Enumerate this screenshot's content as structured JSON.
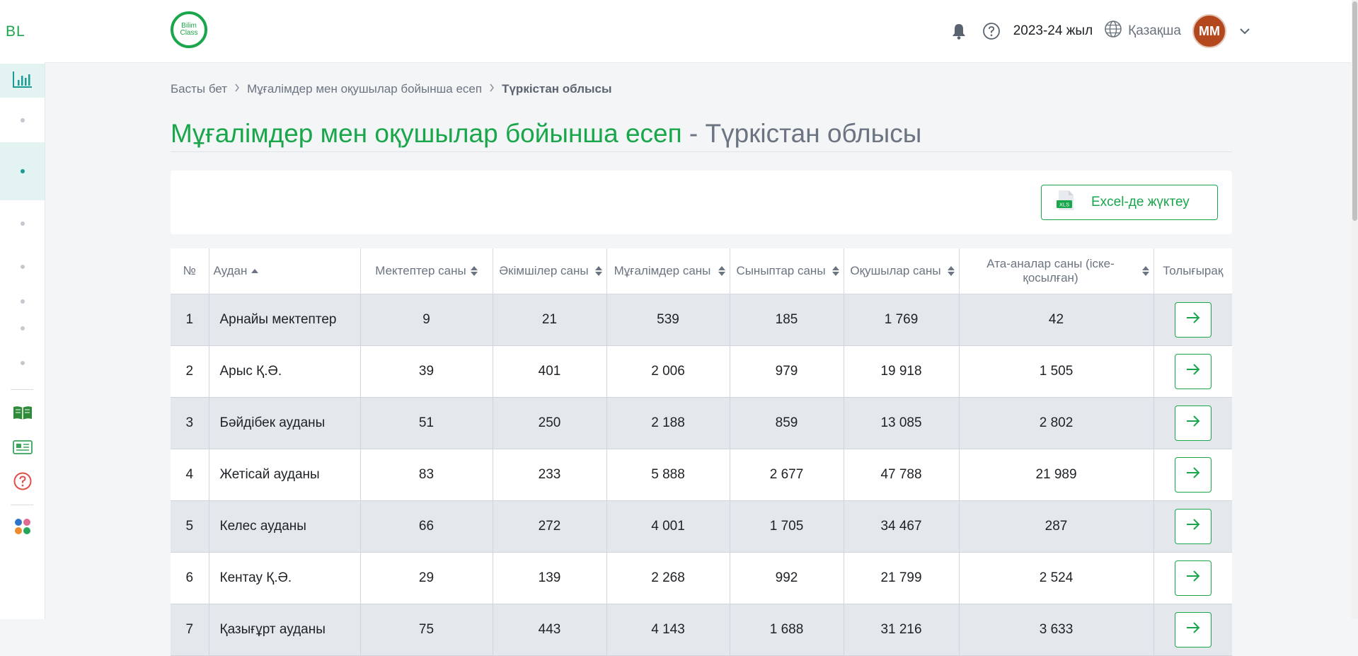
{
  "sidebar": {
    "logo": "BL",
    "items": [
      {
        "icon": "bar-chart-icon",
        "active": true
      },
      {
        "icon": "dot"
      },
      {
        "icon": "dot",
        "active": true
      },
      {
        "icon": "dot"
      },
      {
        "icon": "dot"
      },
      {
        "icon": "dot"
      },
      {
        "icon": "dot"
      },
      {
        "icon": "dot"
      },
      {
        "icon": "book-icon"
      },
      {
        "icon": "news-icon"
      },
      {
        "icon": "help-icon"
      },
      {
        "icon": "apps-icon"
      }
    ]
  },
  "header": {
    "brand_line1": "Bilim",
    "brand_line2": "Class",
    "year": "2023-24 жыл",
    "language": "Қазақша",
    "avatar_initials": "MM"
  },
  "breadcrumb": {
    "home": "Басты бет",
    "report": "Мұғалімдер мен оқушылар бойынша есеп",
    "current": "Түркістан облысы"
  },
  "title": {
    "main": "Мұғалімдер мен оқушылар бойынша есеп",
    "region": " - Түркістан облысы"
  },
  "toolbar": {
    "excel_label": "Excel-де жүктеу",
    "excel_badge": "XLS"
  },
  "table": {
    "headers": {
      "num": "№",
      "district": "Аудан",
      "schools": "Мектептер саны",
      "admins": "Әкімшілер саны",
      "teachers": "Мұғалімдер саны",
      "classes": "Сыныптар саны",
      "students": "Оқушылар саны",
      "parents": "Ата-аналар саны (іске-қосылған)",
      "more": "Толығырақ"
    },
    "rows": [
      {
        "num": "1",
        "district": "Арнайы мектептер",
        "schools": "9",
        "admins": "21",
        "teachers": "539",
        "classes": "185",
        "students": "1 769",
        "parents": "42"
      },
      {
        "num": "2",
        "district": "Арыс Қ.Ә.",
        "schools": "39",
        "admins": "401",
        "teachers": "2 006",
        "classes": "979",
        "students": "19 918",
        "parents": "1 505"
      },
      {
        "num": "3",
        "district": "Бәйдібек ауданы",
        "schools": "51",
        "admins": "250",
        "teachers": "2 188",
        "classes": "859",
        "students": "13 085",
        "parents": "2 802"
      },
      {
        "num": "4",
        "district": "Жетісай ауданы",
        "schools": "83",
        "admins": "233",
        "teachers": "5 888",
        "classes": "2 677",
        "students": "47 788",
        "parents": "21 989"
      },
      {
        "num": "5",
        "district": "Келес ауданы",
        "schools": "66",
        "admins": "272",
        "teachers": "4 001",
        "classes": "1 705",
        "students": "34 467",
        "parents": "287"
      },
      {
        "num": "6",
        "district": "Кентау Қ.Ә.",
        "schools": "29",
        "admins": "139",
        "teachers": "2 268",
        "classes": "992",
        "students": "21 799",
        "parents": "2 524"
      },
      {
        "num": "7",
        "district": "Қазығұрт ауданы",
        "schools": "75",
        "admins": "443",
        "teachers": "4 143",
        "classes": "1 688",
        "students": "31 216",
        "parents": "3 633"
      }
    ]
  },
  "colors": {
    "brand_green": "#1aa64b",
    "sidebar_teal": "#1a9c95",
    "avatar_bg": "#b3481f"
  }
}
